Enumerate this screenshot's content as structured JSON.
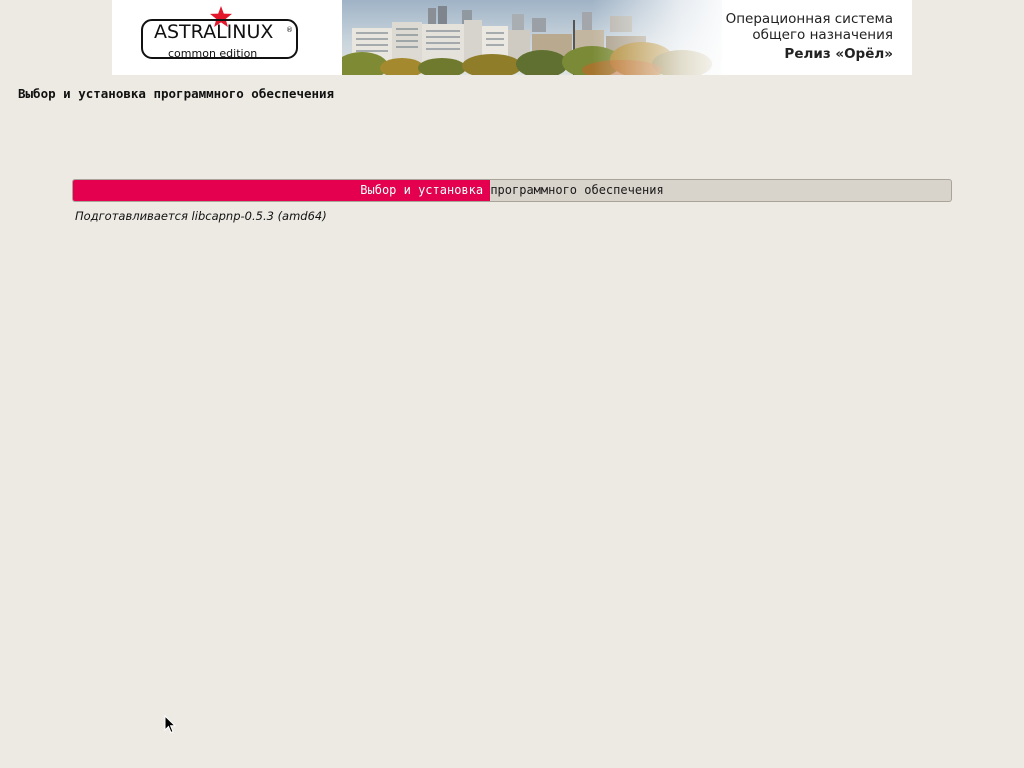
{
  "banner": {
    "logo": {
      "name": "ASTRALINUX",
      "registered": "®",
      "edition": "common edition",
      "star_color": "#e3172b"
    },
    "os_line1": "Операционная система",
    "os_line2": "общего назначения",
    "release": "Релиз «Орёл»",
    "photo": "city-panorama-image"
  },
  "page": {
    "title": "Выбор и установка программного обеспечения"
  },
  "progress": {
    "label": "Выбор и установка программного обеспечения",
    "fraction": 0.475,
    "fill_color": "#e5004f",
    "status": "Подготавливается  libcapnp-0.5.3 (amd64)"
  },
  "cursor": {
    "icon": "mouse-pointer-icon"
  }
}
